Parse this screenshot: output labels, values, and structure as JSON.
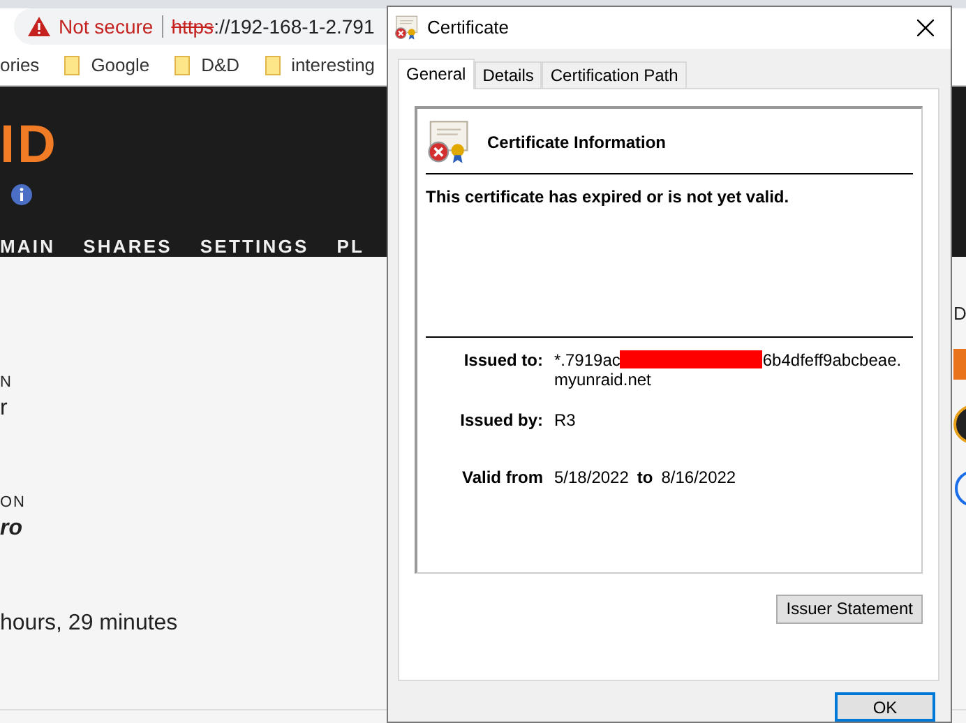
{
  "browser": {
    "security_label": "Not secure",
    "url_scheme": "https",
    "url_rest": "://192-168-1-2.791"
  },
  "bookmarks": [
    {
      "kind": "text",
      "label": "ories"
    },
    {
      "kind": "folder",
      "label": "Google"
    },
    {
      "kind": "folder",
      "label": "D&D"
    },
    {
      "kind": "folder",
      "label": "interesting"
    }
  ],
  "app": {
    "logo": "ID",
    "nav": [
      "MAIN",
      "SHARES",
      "SETTINGS",
      "PL"
    ],
    "content": [
      {
        "kind": "label",
        "text": "N"
      },
      {
        "kind": "value",
        "text": "r"
      },
      {
        "kind": "label",
        "text": "ON"
      },
      {
        "kind": "emphasis",
        "text": "ro"
      },
      {
        "kind": "value",
        "text": "hours, 29 minutes"
      }
    ],
    "side_text": "D"
  },
  "dialog": {
    "title": "Certificate",
    "tabs": [
      {
        "label": "General",
        "selected": true
      },
      {
        "label": "Details",
        "selected": false
      },
      {
        "label": "Certification Path",
        "selected": false
      }
    ],
    "heading": "Certificate Information",
    "status": "This certificate has expired or is not yet valid.",
    "issued_to_label": "Issued to:",
    "issued_to_start": "*.7919ac",
    "issued_to_end": "6b4dfeff9abcbeae.",
    "issued_to_domain": "myunraid.net",
    "issued_by_label": "Issued by:",
    "issued_by": "R3",
    "valid_from_label": "Valid from",
    "valid_from": "5/18/2022",
    "valid_to_label": "to",
    "valid_to": "8/16/2022",
    "issuer_button": "Issuer Statement",
    "ok_button": "OK"
  }
}
